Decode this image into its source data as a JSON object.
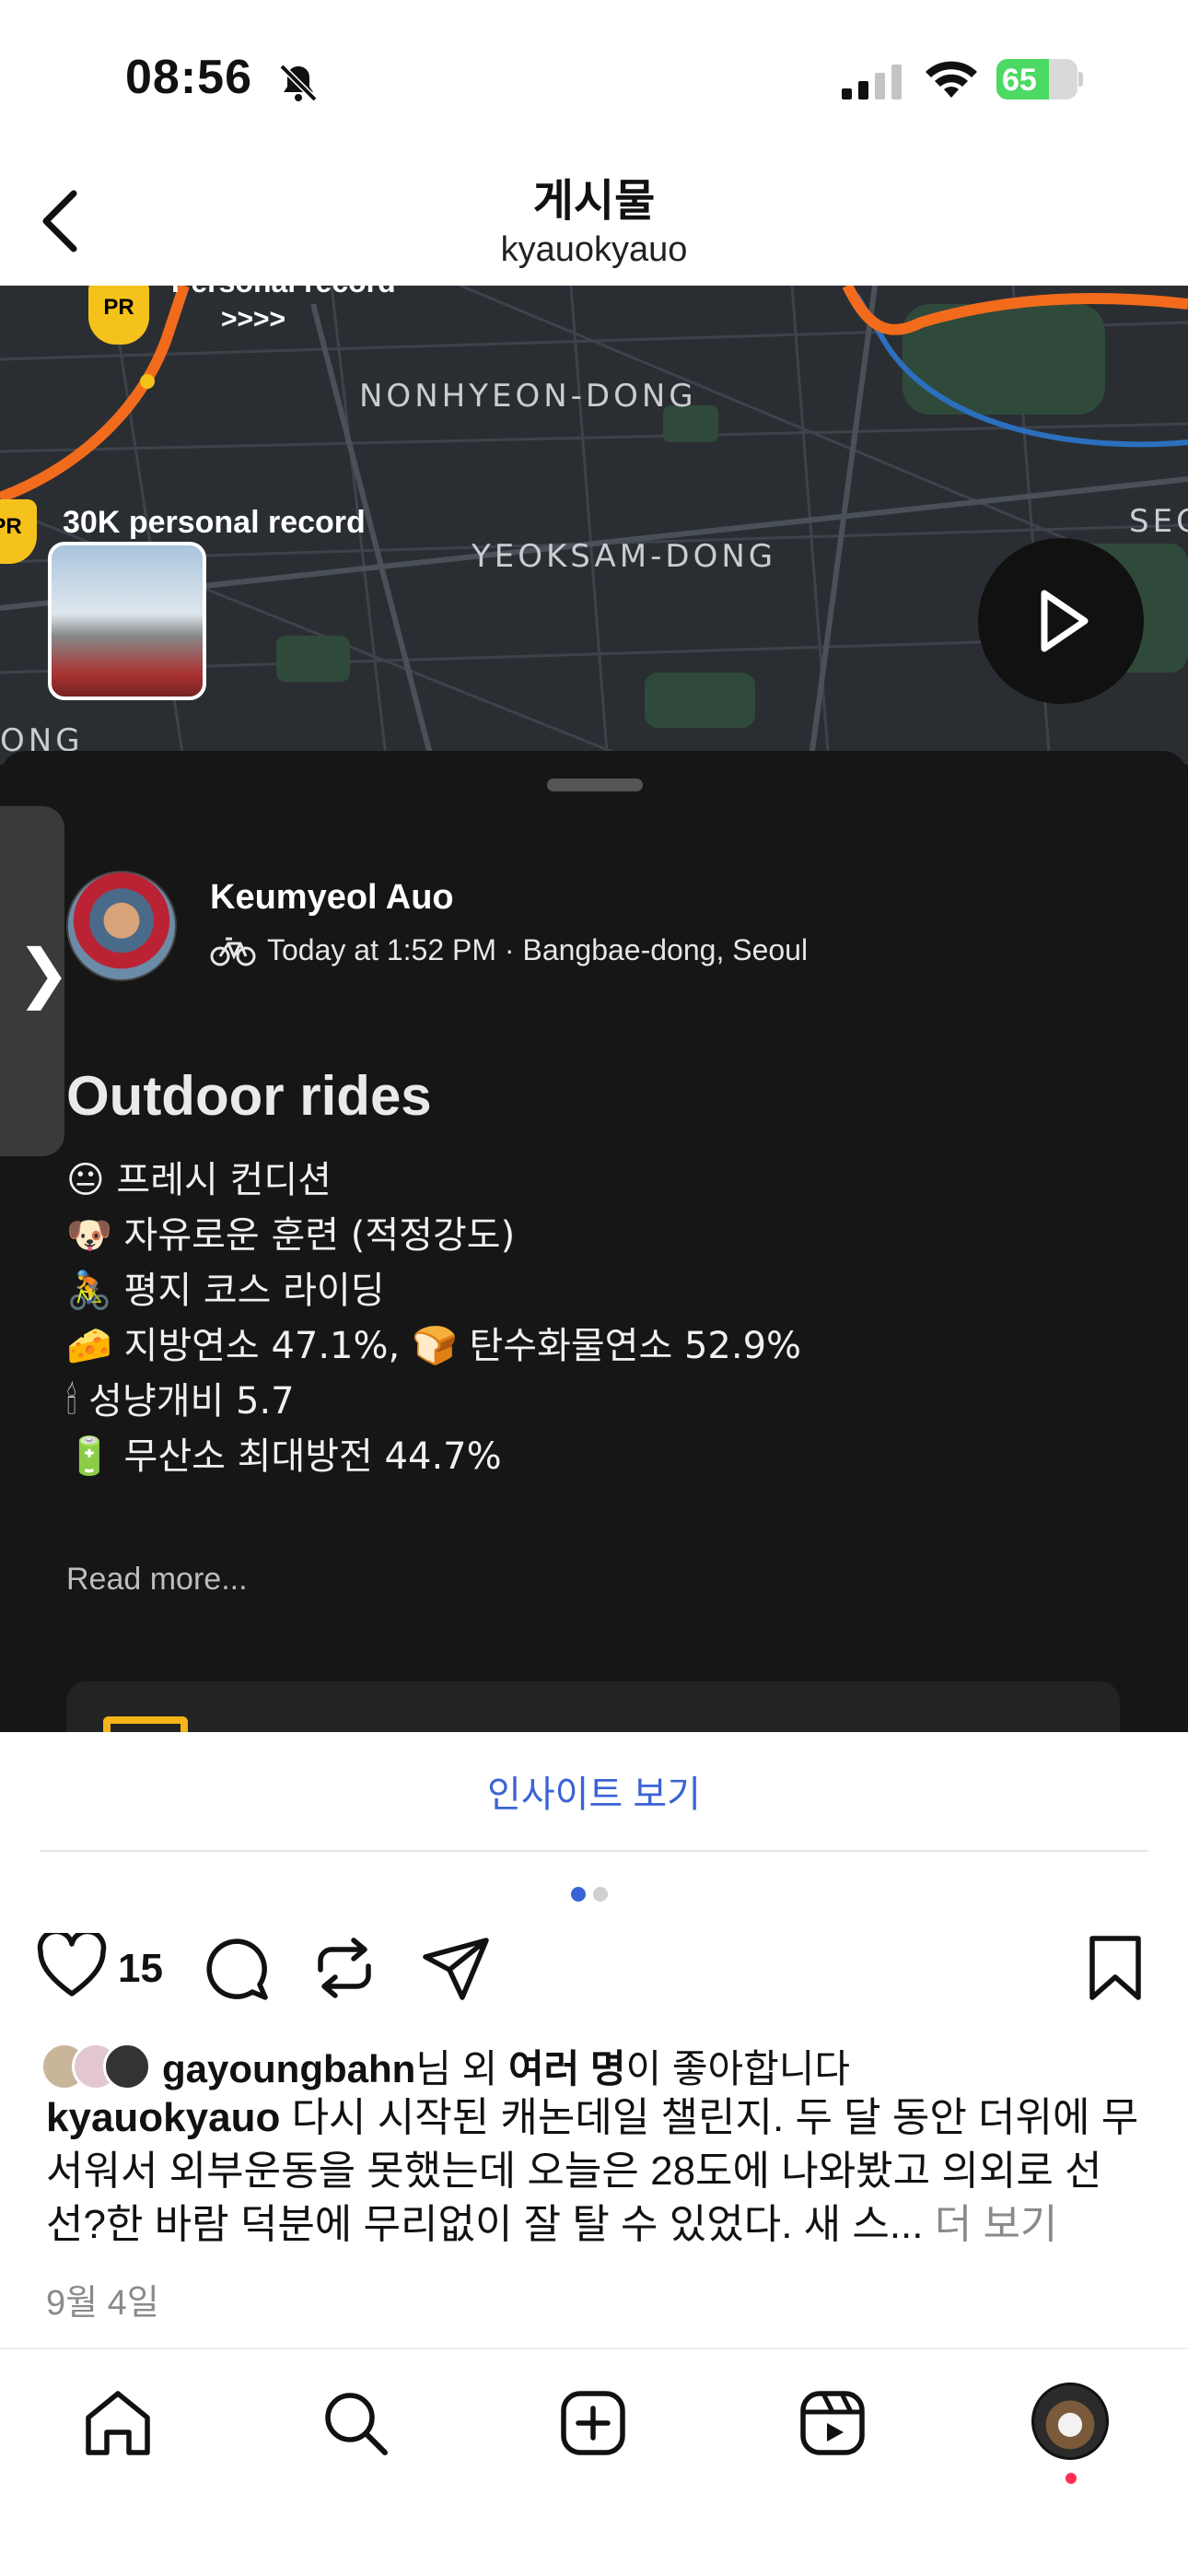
{
  "status_bar": {
    "time": "08:56",
    "battery": "65",
    "battery_level": 0.65
  },
  "header": {
    "title": "게시물",
    "username": "kyauokyauo"
  },
  "post": {
    "map": {
      "labels": [
        "NONHYEON-DONG",
        "YEOKSAM-DONG",
        "SEC",
        "ONG"
      ],
      "pr_top": "Personal record",
      "pr_arrows": ">>>>",
      "pr_label": "30K personal record",
      "pr_badge": "PR"
    },
    "activity": {
      "user": "Keumyeol Auo",
      "meta": "Today at 1:52 PM · Bangbae-dong, Seoul",
      "title": "Outdoor rides",
      "lines": [
        {
          "emoji": "😐",
          "text": "프레시 컨디션"
        },
        {
          "emoji": "🐶",
          "text": "자유로운 훈련 (적정강도)"
        },
        {
          "emoji": "🚴",
          "text": "평지 코스 라이딩"
        },
        {
          "emoji": "🧀",
          "text": "지방연소 47.1%, 🍞 탄수화물연소 52.9%"
        },
        {
          "emoji": "🕯",
          "text": "성냥개비 5.7"
        },
        {
          "emoji": "🔋",
          "text": "무산소 최대방전 44.7%"
        }
      ],
      "read_more": "Read more..."
    }
  },
  "insight_link": "인사이트 보기",
  "actions": {
    "like_count": "15"
  },
  "likes": {
    "user": "gayoungbahn",
    "mid": "님 외 ",
    "bold": "여러 명",
    "tail": "이 좋아합니다"
  },
  "caption": {
    "user": "kyauokyauo",
    "text": " 다시 시작된 캐논데일 챌린지. 두 달 동안 더위에 무서워서 외부운동을 못했는데 오늘은 28도에 나와봤고 의외로 선선?한 바람 덕분에 무리없이 잘 탈 수 있었다. 새 스...",
    "more": " 더 보기"
  },
  "date": "9월 4일",
  "colors": {
    "accent": "#3b63d6",
    "route": "#f26b1d",
    "dark": "#161616"
  },
  "icons": [
    "bell-slash-icon",
    "signal-icon",
    "wifi-icon",
    "battery-icon",
    "back-icon",
    "play-icon",
    "bike-icon",
    "heart-icon",
    "comment-icon",
    "repost-icon",
    "share-icon",
    "bookmark-icon",
    "home-icon",
    "search-icon",
    "create-icon",
    "reels-icon"
  ]
}
